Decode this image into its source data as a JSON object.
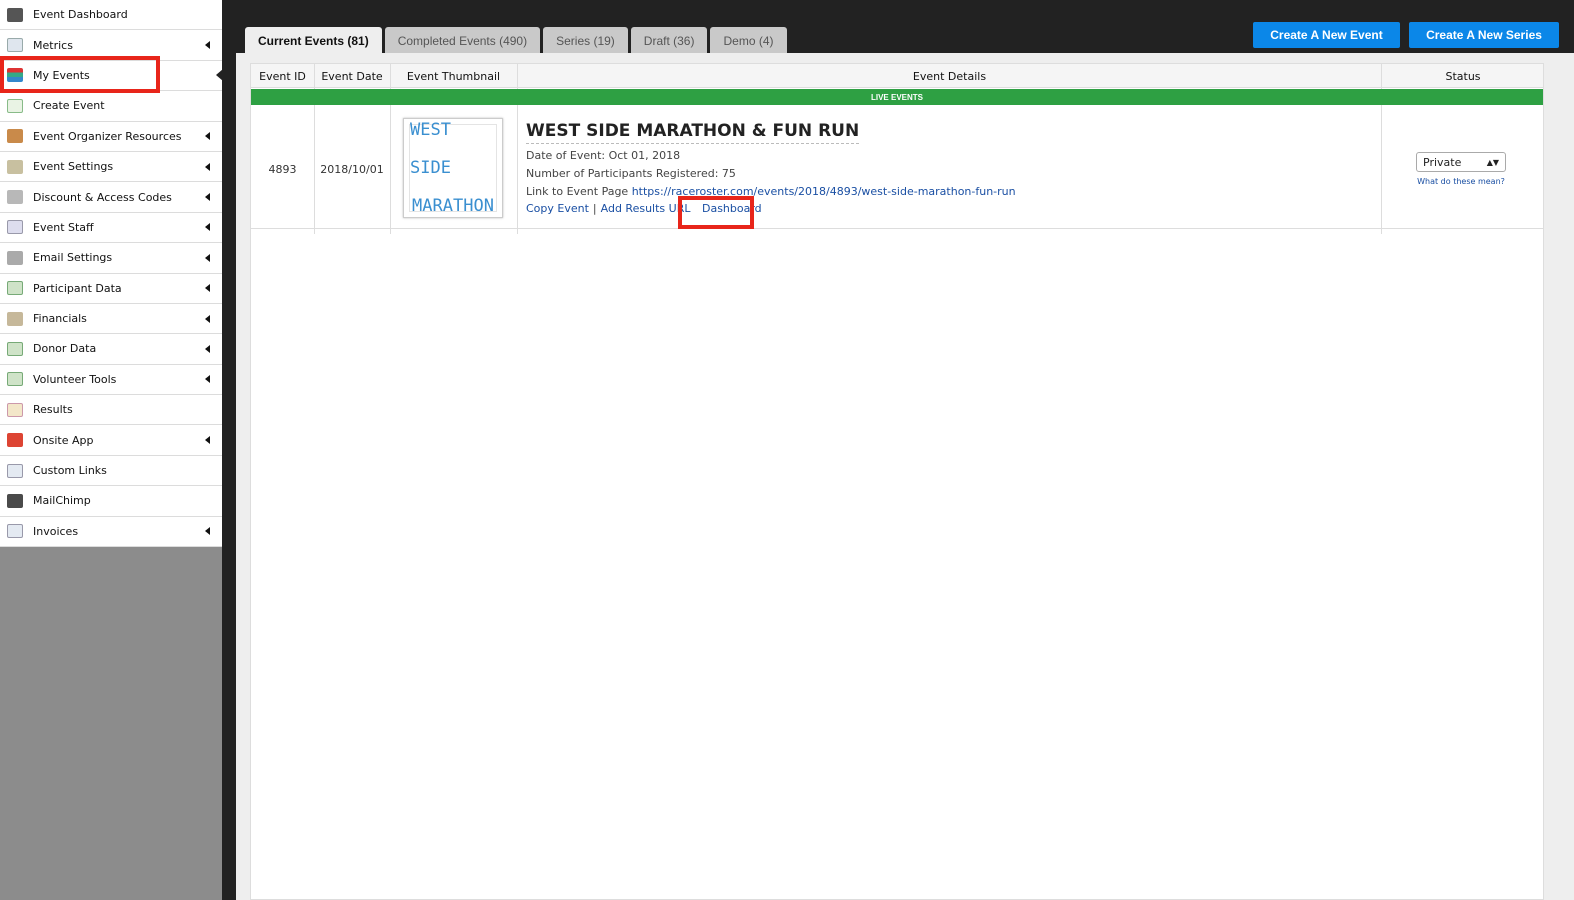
{
  "sidebar": {
    "items": [
      {
        "label": "Event Dashboard",
        "icon": "dashboard-icon",
        "submenu": false
      },
      {
        "label": "Metrics",
        "icon": "metrics-icon",
        "submenu": true
      },
      {
        "label": "My Events",
        "icon": "calendar-icon",
        "submenu": false
      },
      {
        "label": "Create Event",
        "icon": "create-event-icon",
        "submenu": false
      },
      {
        "label": "Event Organizer Resources",
        "icon": "resources-icon",
        "submenu": true
      },
      {
        "label": "Event Settings",
        "icon": "settings-icon",
        "submenu": true
      },
      {
        "label": "Discount & Access Codes",
        "icon": "discount-icon",
        "submenu": true
      },
      {
        "label": "Event Staff",
        "icon": "staff-icon",
        "submenu": true
      },
      {
        "label": "Email Settings",
        "icon": "email-icon",
        "submenu": true
      },
      {
        "label": "Participant Data",
        "icon": "spreadsheet-icon",
        "submenu": true
      },
      {
        "label": "Financials",
        "icon": "financials-icon",
        "submenu": true
      },
      {
        "label": "Donor Data",
        "icon": "spreadsheet-icon",
        "submenu": true
      },
      {
        "label": "Volunteer Tools",
        "icon": "spreadsheet-icon",
        "submenu": true
      },
      {
        "label": "Results",
        "icon": "results-icon",
        "submenu": false
      },
      {
        "label": "Onsite App",
        "icon": "megaphone-icon",
        "submenu": true
      },
      {
        "label": "Custom Links",
        "icon": "document-icon",
        "submenu": false
      },
      {
        "label": "MailChimp",
        "icon": "mailchimp-icon",
        "submenu": false
      },
      {
        "label": "Invoices",
        "icon": "invoice-icon",
        "submenu": true
      }
    ],
    "active_item": "My Events"
  },
  "tabs": [
    {
      "label": "Current Events (81)",
      "active": true
    },
    {
      "label": "Completed Events (490)",
      "active": false
    },
    {
      "label": "Series (19)",
      "active": false
    },
    {
      "label": "Draft (36)",
      "active": false
    },
    {
      "label": "Demo (4)",
      "active": false
    }
  ],
  "buttons": {
    "create_event": "Create A New Event",
    "create_series": "Create A New Series"
  },
  "table": {
    "headers": [
      "Event ID",
      "Event Date",
      "Event Thumbnail",
      "Event Details",
      "Status"
    ],
    "section_label": "LIVE EVENTS",
    "rows": [
      {
        "event_id": "4893",
        "event_date": "2018/10/01",
        "thumbnail_line1": "WEST SIDE",
        "thumbnail_line2": "MARATHON",
        "title": "WEST SIDE MARATHON & FUN RUN",
        "date_label": "Date of Event: Oct 01, 2018",
        "participants_label": "Number of Participants Registered: 75",
        "link_prefix": "Link to Event Page",
        "link_url": "https://raceroster.com/events/2018/4893/west-side-marathon-fun-run",
        "action_copy": "Copy Event",
        "action_separator": "|",
        "action_results": "Add Results URL",
        "action_dashboard": "Dashboard",
        "status_value": "Private",
        "status_help": "What do these mean?"
      }
    ]
  },
  "colors": {
    "highlight": "#e8251a",
    "primary_button": "#0b87e8",
    "live_bar": "#2ea043",
    "link": "#1a4fa3"
  }
}
